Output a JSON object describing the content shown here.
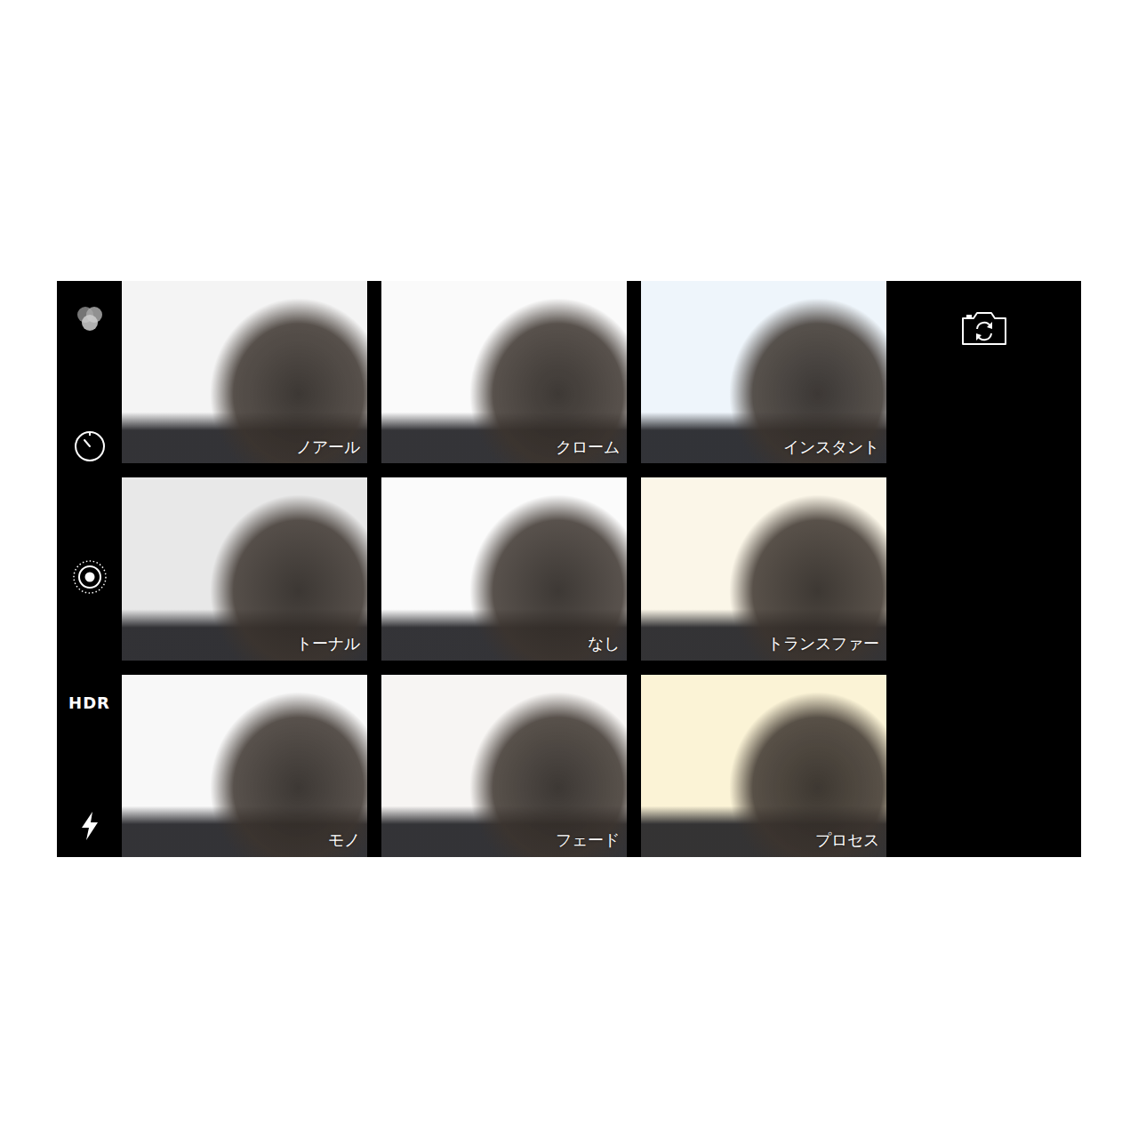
{
  "controls": {
    "hdr_label": "HDR"
  },
  "filters": [
    {
      "name": "ノアール",
      "color": "#f4f4f4"
    },
    {
      "name": "クローム",
      "color": "#fafafa"
    },
    {
      "name": "インスタント",
      "color": "#eef5fb"
    },
    {
      "name": "トーナル",
      "color": "#e8e8e8"
    },
    {
      "name": "なし",
      "color": "#fbfbfb"
    },
    {
      "name": "トランスファー",
      "color": "#fbf6e8"
    },
    {
      "name": "モノ",
      "color": "#f8f8f8"
    },
    {
      "name": "フェード",
      "color": "#f7f5f3"
    },
    {
      "name": "プロセス",
      "color": "#fbf3d6"
    }
  ]
}
